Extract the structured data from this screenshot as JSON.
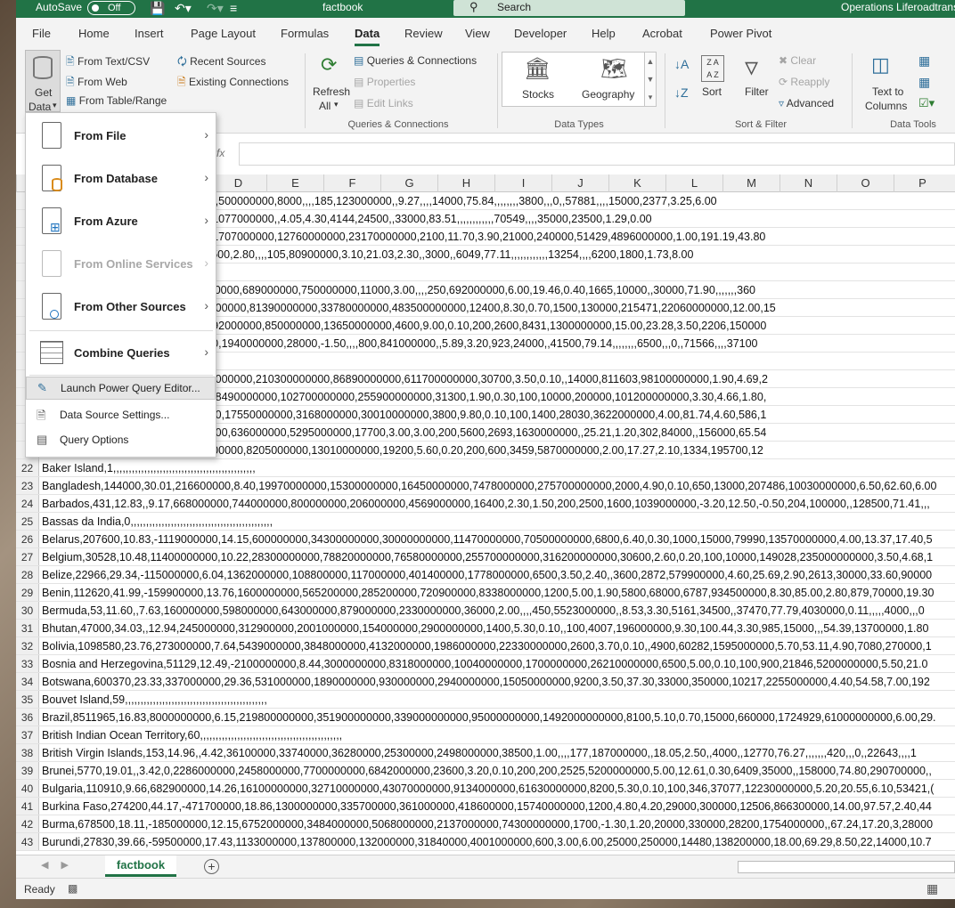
{
  "titlebar": {
    "autosave": "AutoSave",
    "toggle": "Off",
    "filename": "factbook",
    "search": "Search",
    "right": "Operations Liferoadtrans"
  },
  "menu": [
    "File",
    "Home",
    "Insert",
    "Page Layout",
    "Formulas",
    "Data",
    "Review",
    "View",
    "Developer",
    "Help",
    "Acrobat",
    "Power Pivot"
  ],
  "ribbon": {
    "get_data": "Get",
    "get_data2": "Data",
    "from_text_csv": "From Text/CSV",
    "from_web": "From Web",
    "from_table_range": "From Table/Range",
    "recent_sources": "Recent Sources",
    "existing_connections": "Existing Connections",
    "refresh": "Refresh",
    "refresh_all": "All",
    "queries_connections": "Queries & Connections",
    "properties": "Properties",
    "edit_links": "Edit Links",
    "group_queries": "Queries & Connections",
    "stocks": "Stocks",
    "geography": "Geography",
    "group_datatypes": "Data Types",
    "sort": "Sort",
    "filter": "Filter",
    "clear": "Clear",
    "reapply": "Reapply",
    "advanced": "Advanced",
    "group_sortfilter": "Sort & Filter",
    "text_to_columns": "Text to",
    "text_to_columns2": "Columns",
    "group_datatools": "Data Tools",
    "fx": "fx"
  },
  "columns": [
    "D",
    "E",
    "F",
    "G",
    "H",
    "I",
    "J",
    "K",
    "L",
    "M",
    "N",
    "O",
    "P"
  ],
  "dropdown": {
    "from_file": "From File",
    "from_database": "From Database",
    "from_azure": "From Azure",
    "from_online": "From Online Services",
    "from_other": "From Other Sources",
    "combine": "Combine Queries",
    "launch_pq": "Launch Power Query Editor...",
    "ds_settings": "Data Source Settings...",
    "query_options": "Query Options"
  },
  "rows": [
    {
      "n": "",
      "v": ",,120900000,130000000,30000000,500000000,8000,,,,185,123000000,,9.27,,,,14000,75.84,,,,,,,,3800,,,0,,57881,,,,15000,2377,3.25,6.00"
    },
    {
      "n": "",
      "v": "00,1900000000,26800,2.00,,,,269,1077000000,,4.05,4.30,4144,24500,,33000,83.51,,,,,,,,,,,,70549,,,,35000,23500,1.29,0.00"
    },
    {
      "n": "",
      "v": ",25.90,10450000000,1587000000,1707000000,12760000000,23170000000,2100,11.70,3.90,21000,240000,51429,4896000000,1.00,191.19,43.80"
    },
    {
      "n": "",
      "v": ",42600000,,2600000,112000000,7500,2.80,,,,105,80900000,3.10,21.03,2.30,,3000,,6049,77.11,,,,,,,,,,,,13254,,,,6200,1800,1.73,8.00"
    },
    {
      "n": "",
      "v": ",,,,,,,,,,,,,,,,,,,,,,,,,,,,,,,,0,,,"
    },
    {
      "n": "",
      "v": "5.44,231000000,103000000,110800000,689000000,750000000,11000,3.00,,,,250,692000000,6.00,19.46,0.40,1665,10000,,30000,71.90,,,,,,,360"
    },
    {
      "n": "",
      "v": "00000,7.56,157700000000,81650000000,81390000000,33780000000,483500000000,12400,8.30,0.70,1500,130000,215471,22060000000,12.00,15"
    },
    {
      "n": "",
      "v": "0,8.16,905000000,5797000000,6492000000,850000000,13650000000,4600,9.00,0.10,200,2600,8431,1300000000,15.00,23.28,3.50,2206,150000"
    },
    {
      "n": "",
      "v": ",751200000,807700000,128000000,1940000000,28000,-1.50,,,,800,841000000,,5.89,3.20,923,24000,,41500,79.14,,,,,,,,6500,,,0,,71566,,,,37100"
    },
    {
      "n": "",
      "v": ",,,,,,,,,,,,,,,,,,,,,,,,,,,,,,,,,,,,,,,,,,,,,,"
    },
    {
      "n": "",
      "v": "00000,7.44,308700000000,195600000000,210300000000,86890000000,611700000000,30700,3.50,0.10,,14000,811603,98100000000,1.90,4.69,2"
    },
    {
      "n": "",
      "v": "9.70,15500000000,55090000000,58490000000,102700000000,255900000000,31300,1.90,0.30,100,10000,200000,101200000000,3.30,4.66,1.80,"
    },
    {
      "n": "",
      "v": "000,9.86,1832000000,17370000000,17550000000,3168000000,30010000000,3800,9.80,0.10,100,1400,28030,3622000000,4.00,81.74,4.60,586,1"
    },
    {
      "n": "",
      "v": "308500000,1596000000,1716000000,636000000,5295000000,17700,3.00,3.00,200,5600,2693,1630000000,,25.21,1.20,302,84000,,156000,65.54"
    },
    {
      "n": "",
      "v": "8,6215000000,6379000000,6860000000,8205000000,13010000000,19200,5.60,0.20,200,600,3459,5870000000,2.00,17.27,2.10,1334,195700,12"
    },
    {
      "n": "22",
      "v": "Baker Island,1,,,,,,,,,,,,,,,,,,,,,,,,,,,,,,,,,,,,,,,,,,,,,,"
    },
    {
      "n": "23",
      "v": "Bangladesh,144000,30.01,216600000,8.40,19970000000,15300000000,16450000000,7478000000,275700000000,2000,4.90,0.10,650,13000,207486,10030000000,6.50,62.60,6.00"
    },
    {
      "n": "24",
      "v": "Barbados,431,12.83,,9.17,668000000,744000000,800000000,206000000,4569000000,16400,2.30,1.50,200,2500,1600,1039000000,-3.20,12.50,-0.50,204,100000,,128500,71.41,,,"
    },
    {
      "n": "25",
      "v": "Bassas da India,0,,,,,,,,,,,,,,,,,,,,,,,,,,,,,,,,,,,,,,,,,,,,,,"
    },
    {
      "n": "26",
      "v": "Belarus,207600,10.83,-1119000000,14.15,600000000,34300000000,30000000000,11470000000,70500000000,6800,6.40,0.30,1000,15000,79990,13570000000,4.00,13.37,17.40,5"
    },
    {
      "n": "27",
      "v": "Belgium,30528,10.48,11400000000,10.22,28300000000,78820000000,76580000000,255700000000,316200000000,30600,2.60,0.20,100,10000,149028,235000000000,3.50,4.68,1"
    },
    {
      "n": "28",
      "v": "Belize,22966,29.34,-115000000,6.04,1362000000,108800000,117000000,401400000,1778000000,6500,3.50,2.40,,3600,2872,579900000,4.60,25.69,2.90,2613,30000,33.60,90000"
    },
    {
      "n": "29",
      "v": "Benin,112620,41.99,-159900000,13.76,1600000000,565200000,285200000,720900000,8338000000,1200,5.00,1.90,5800,68000,6787,934500000,8.30,85.00,2.80,879,70000,19.30"
    },
    {
      "n": "30",
      "v": "Bermuda,53,11.60,,7.63,160000000,598000000,643000000,879000000,2330000000,36000,2.00,,,,450,5523000000,,8.53,3.30,5161,34500,,37470,77.79,4030000,0.11,,,,,4000,,,0"
    },
    {
      "n": "31",
      "v": "Bhutan,47000,34.03,,12.94,245000000,312900000,2001000000,154000000,2900000000,1400,5.30,0.10,,100,4007,196000000,9.30,100.44,3.30,985,15000,,,54.39,13700000,1.80"
    },
    {
      "n": "32",
      "v": "Bolivia,1098580,23.76,273000000,7.64,5439000000,3848000000,4132000000,1986000000,22330000000,2600,3.70,0.10,,4900,60282,1595000000,5.70,53.11,4.90,7080,270000,1"
    },
    {
      "n": "33",
      "v": "Bosnia and Herzegovina,51129,12.49,-2100000000,8.44,3000000000,8318000000,10040000000,1700000000,26210000000,6500,5.00,0.10,100,900,21846,5200000000,5.50,21.0"
    },
    {
      "n": "34",
      "v": "Botswana,600370,23.33,337000000,29.36,531000000,1890000000,930000000,2940000000,15050000000,9200,3.50,37.30,33000,350000,10217,2255000000,4.40,54.58,7.00,192"
    },
    {
      "n": "35",
      "v": "Bouvet Island,59,,,,,,,,,,,,,,,,,,,,,,,,,,,,,,,,,,,,,,,,,,,,,,"
    },
    {
      "n": "36",
      "v": "Brazil,8511965,16.83,8000000000,6.15,219800000000,351900000000,339000000000,95000000000,1492000000000,8100,5.10,0.70,15000,660000,1724929,61000000000,6.00,29."
    },
    {
      "n": "37",
      "v": "British Indian Ocean Territory,60,,,,,,,,,,,,,,,,,,,,,,,,,,,,,,,,,,,,,,,,,,,,,,"
    },
    {
      "n": "38",
      "v": "British Virgin Islands,153,14.96,,4.42,36100000,33740000,36280000,25300000,2498000000,38500,1.00,,,,177,187000000,,18.05,2.50,,4000,,12770,76.27,,,,,,,420,,,0,,22643,,,,1"
    },
    {
      "n": "39",
      "v": "Brunei,5770,19.01,,3.42,0,2286000000,2458000000,7700000000,6842000000,23600,3.20,0.10,200,200,2525,5200000000,5.00,12.61,0.30,6409,35000,,158000,74.80,290700000,,"
    },
    {
      "n": "40",
      "v": "Bulgaria,110910,9.66,682900000,14.26,16100000000,32710000000,43070000000,9134000000,61630000000,8200,5.30,0.10,100,346,37077,12230000000,5.20,20.55,6.10,53421,("
    },
    {
      "n": "41",
      "v": "Burkina Faso,274200,44.17,-471700000,18.86,1300000000,335700000,361000000,418600000,15740000000,1200,4.80,4.20,29000,300000,12506,866300000,14.00,97.57,2.40,44"
    },
    {
      "n": "42",
      "v": "Burma,678500,18.11,-185000000,12.15,6752000000,3484000000,5068000000,2137000000,74300000000,1700,-1.30,1.20,20000,330000,28200,1754000000,,67.24,17.20,3,28000"
    },
    {
      "n": "43",
      "v": "Burundi,27830,39.66,-59500000,17.43,1133000000,137800000,132000000,31840000,4001000000,600,3.00,6.00,25000,250000,14480,138200000,18.00,69.29,8.50,22,14000,10.7"
    }
  ],
  "sheet": {
    "tab": "factbook",
    "add": "+"
  },
  "status": {
    "ready": "Ready"
  }
}
